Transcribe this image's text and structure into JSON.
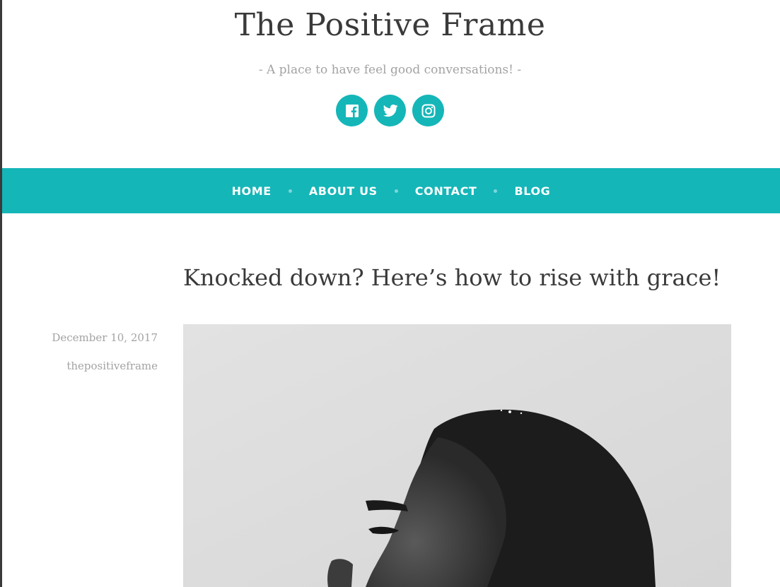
{
  "site": {
    "title": "The Positive Frame",
    "tagline": "- A place to have feel good conversations! -"
  },
  "social": [
    {
      "name": "facebook",
      "icon": "facebook-icon"
    },
    {
      "name": "twitter",
      "icon": "twitter-icon"
    },
    {
      "name": "instagram",
      "icon": "instagram-icon"
    }
  ],
  "nav": {
    "items": [
      {
        "label": "HOME"
      },
      {
        "label": "ABOUT US"
      },
      {
        "label": "CONTACT"
      },
      {
        "label": "BLOG"
      }
    ]
  },
  "post": {
    "title": "Knocked down? Here’s how to rise with grace!",
    "date": "December 10, 2017",
    "author": "thepositiveframe",
    "image_icon": "portrait-photo"
  },
  "colors": {
    "accent": "#15b6b8",
    "text": "#3a3a3a",
    "muted": "#a3a3a3"
  }
}
